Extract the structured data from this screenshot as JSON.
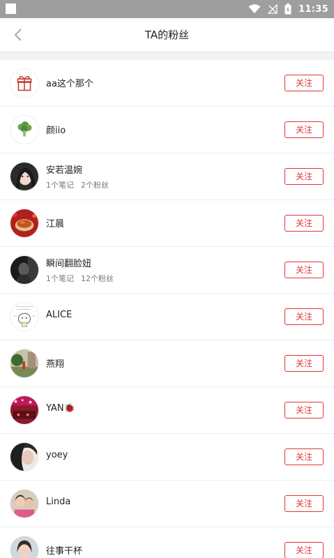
{
  "status_bar": {
    "time": "11:35",
    "icons": [
      "wifi-icon",
      "signal-off-icon",
      "battery-charging-icon"
    ]
  },
  "header": {
    "title": "TA的粉丝",
    "back_icon": "chevron-left-icon"
  },
  "follow_label": "关注",
  "followers": [
    {
      "name": "aa这个那个",
      "avatar": "gift-avatar",
      "notes": "",
      "fans": "",
      "follow": "关注"
    },
    {
      "name": "颜iio",
      "avatar": "broccoli-avatar",
      "notes": "",
      "fans": "",
      "follow": "关注"
    },
    {
      "name": "安若温婉",
      "avatar": "woman-portrait-avatar",
      "notes": "1个笔记",
      "fans": "2个粉丝",
      "follow": "关注"
    },
    {
      "name": "江晨",
      "avatar": "food-photo-avatar",
      "notes": "",
      "fans": "",
      "follow": "关注"
    },
    {
      "name": "瞬间翻脸妞",
      "avatar": "dark-portrait-avatar",
      "notes": "1个笔记",
      "fans": "12个粉丝",
      "follow": "关注"
    },
    {
      "name": "ALICE",
      "avatar": "cartoon-avatar",
      "notes": "",
      "fans": "",
      "follow": "关注"
    },
    {
      "name": "燕翔",
      "avatar": "outdoor-photo-avatar",
      "notes": "",
      "fans": "",
      "follow": "关注"
    },
    {
      "name": "YAN🐞",
      "avatar": "red-lights-avatar",
      "notes": "",
      "fans": "",
      "follow": "关注"
    },
    {
      "name": "yoey",
      "avatar": "selfie-avatar",
      "notes": "",
      "fans": "",
      "follow": "关注"
    },
    {
      "name": "Linda",
      "avatar": "couple-photo-avatar",
      "notes": "",
      "fans": "",
      "follow": "关注"
    },
    {
      "name": "往事干杯",
      "avatar": "girl-photo-avatar",
      "notes": "",
      "fans": "",
      "follow": "关注"
    }
  ]
}
